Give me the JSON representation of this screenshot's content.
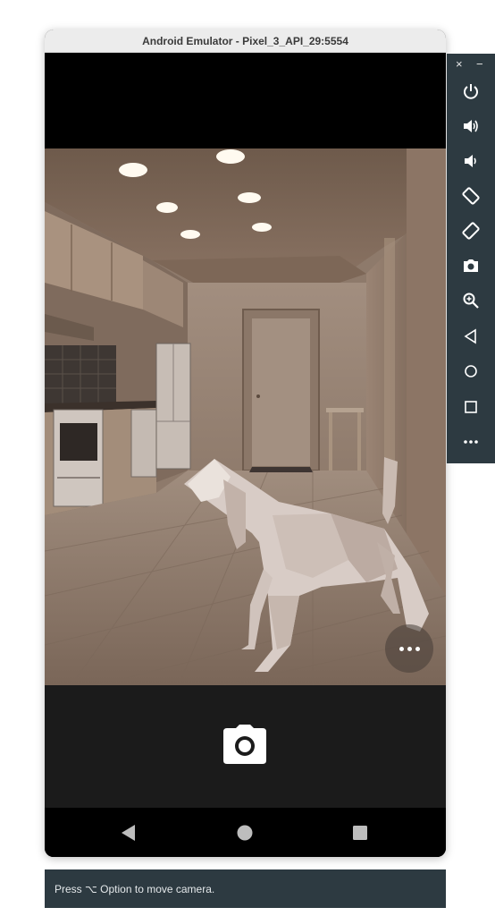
{
  "window": {
    "title": "Android Emulator - Pixel_3_API_29:5554"
  },
  "sidebar": {
    "close_label": "×",
    "minimize_label": "−",
    "buttons": [
      "power-icon",
      "volume-up-icon",
      "volume-down-icon",
      "rotate-left-icon",
      "rotate-right-icon",
      "screenshot-icon",
      "zoom-icon",
      "back-icon",
      "home-icon",
      "overview-icon",
      "more-icon"
    ]
  },
  "camera": {
    "more_button": "more-icon",
    "shutter_button": "camera-icon"
  },
  "navbar": {
    "buttons": [
      "nav-back-icon",
      "nav-home-icon",
      "nav-recent-icon"
    ]
  },
  "hint": {
    "text": "Press ⌥ Option to move camera."
  },
  "colors": {
    "sidebar_bg": "#2d3a41",
    "control_bar_bg": "#1b1b1b",
    "titlebar_bg": "#ececec"
  }
}
